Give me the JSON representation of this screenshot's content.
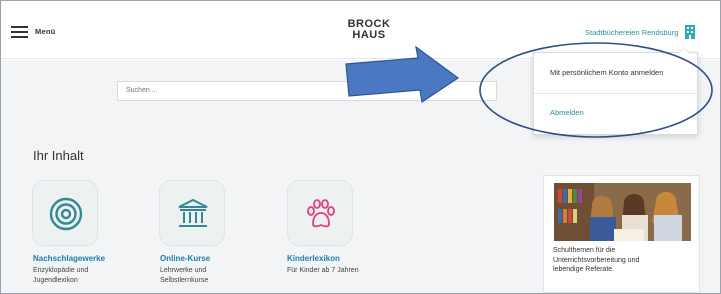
{
  "header": {
    "menu_label": "Menü",
    "logo_line1": "BROCK",
    "logo_line2": "HAUS",
    "library_link": "Stadtbüchereien Rendsburg"
  },
  "search": {
    "placeholder": "Suchen ..."
  },
  "dropdown": {
    "login_label": "Mit persönlichem Konto anmelden",
    "logout_label": "Abmelden"
  },
  "content": {
    "section_title": "Ihr Inhalt",
    "cards": [
      {
        "title": "Nachschlagewerke",
        "desc_line1": "Enzyklopädie und",
        "desc_line2": "Jugendlexikon",
        "icon": "target-icon"
      },
      {
        "title": "Online-Kurse",
        "desc_line1": "Lehrwerke und",
        "desc_line2": "Selbstlernkurse",
        "icon": "museum-icon"
      },
      {
        "title": "Kinderlexikon",
        "desc_line1": "Für Kinder ab 7 Jahren",
        "desc_line2": "",
        "icon": "paw-icon"
      }
    ],
    "side_text_line1": "Schulthemen für die",
    "side_text_line2": "Unterrichtsvorbereitung und",
    "side_text_line3": "lebendige Referate."
  },
  "colors": {
    "accent": "#2b8fa6",
    "link_blue": "#1f7fae",
    "icon_teal": "#2f8a96",
    "paw_pink": "#e0407a",
    "annotation_blue": "#4a78c2"
  }
}
